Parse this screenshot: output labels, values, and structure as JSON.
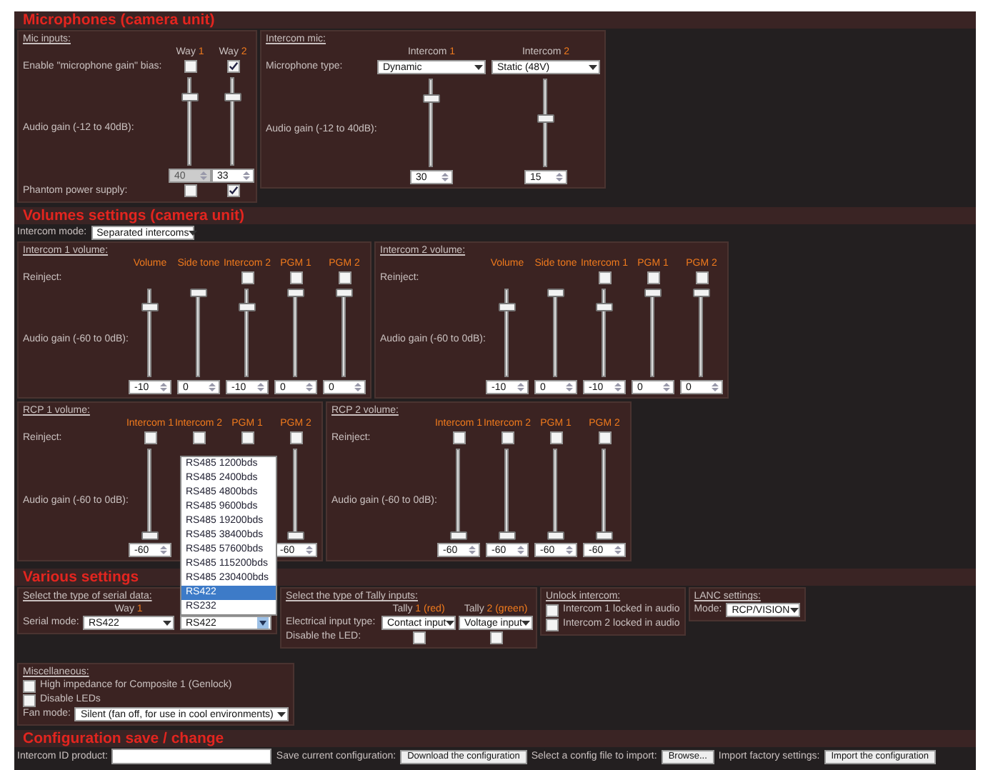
{
  "microphones": {
    "title": "Microphones (camera unit)",
    "panels": [
      {
        "title": "Mic inputs:",
        "columns": [
          {
            "label": "Way ",
            "accent": "1"
          },
          {
            "label": "Way ",
            "accent": "2"
          }
        ],
        "rows": [
          {
            "kind": "checkbox",
            "label": "Enable \"microphone gain\" bias:",
            "cells": [
              {
                "kind": "checkbox",
                "checked": false
              },
              {
                "kind": "checkbox",
                "checked": true
              }
            ]
          },
          {
            "kind": "slider",
            "label": "Audio gain (-12 to 40dB):",
            "cells": [
              {
                "kind": "slider",
                "level": 0.8,
                "value": "40",
                "disabled": true
              },
              {
                "kind": "slider",
                "level": 0.8,
                "value": "33",
                "disabled": false
              }
            ]
          },
          {
            "kind": "checkbox",
            "label": "Phantom power supply:",
            "cells": [
              {
                "kind": "checkbox",
                "checked": false
              },
              {
                "kind": "checkbox",
                "checked": true
              }
            ]
          }
        ]
      },
      {
        "title": "Intercom mic:",
        "columns": [
          {
            "label": "Intercom ",
            "accent": "1"
          },
          {
            "label": "Intercom ",
            "accent": "2"
          }
        ],
        "rows": [
          {
            "kind": "select",
            "label": "Microphone type:",
            "cells": [
              {
                "kind": "select",
                "value": "Dynamic"
              },
              {
                "kind": "select",
                "value": "Static (48V)"
              }
            ]
          },
          {
            "kind": "slider",
            "label": "Audio gain (-12 to 40dB):",
            "cells": [
              {
                "kind": "slider",
                "level": 0.8,
                "value": "30",
                "disabled": false
              },
              {
                "kind": "slider",
                "level": 0.55,
                "value": "15",
                "disabled": false
              }
            ]
          }
        ]
      }
    ]
  },
  "volumes": {
    "title": "Volumes settings (camera unit)",
    "mode_label": "Intercom mode:",
    "mode_value": "Separated intercoms",
    "panels": [
      {
        "title": "Intercom 1 volume:",
        "columns": [
          {
            "accent": "Volume"
          },
          {
            "accent": "Side tone"
          },
          {
            "accent": "Intercom 2"
          },
          {
            "accent": "PGM 1"
          },
          {
            "accent": "PGM 2"
          }
        ],
        "rows": [
          {
            "kind": "checkbox",
            "label": "Reinject:",
            "cells": [
              {
                "kind": "blank"
              },
              {
                "kind": "blank"
              },
              {
                "kind": "checkbox",
                "checked": false
              },
              {
                "kind": "checkbox",
                "checked": false
              },
              {
                "kind": "checkbox",
                "checked": false
              }
            ]
          },
          {
            "kind": "slider",
            "label": "Audio gain (-60 to 0dB):",
            "cells": [
              {
                "kind": "slider",
                "level": 0.83,
                "value": "-10",
                "disabled": false
              },
              {
                "kind": "slider",
                "level": 1,
                "value": "0",
                "disabled": false
              },
              {
                "kind": "slider",
                "level": 0.83,
                "value": "-10",
                "disabled": false
              },
              {
                "kind": "slider",
                "level": 1,
                "value": "0",
                "disabled": false
              },
              {
                "kind": "slider",
                "level": 1,
                "value": "0",
                "disabled": false
              }
            ]
          }
        ]
      },
      {
        "title": "Intercom 2 volume:",
        "columns": [
          {
            "accent": "Volume"
          },
          {
            "accent": "Side tone"
          },
          {
            "accent": "Intercom 1"
          },
          {
            "accent": "PGM 1"
          },
          {
            "accent": "PGM 2"
          }
        ],
        "rows": [
          {
            "kind": "checkbox",
            "label": "Reinject:",
            "cells": [
              {
                "kind": "blank"
              },
              {
                "kind": "blank"
              },
              {
                "kind": "checkbox",
                "checked": false
              },
              {
                "kind": "checkbox",
                "checked": false
              },
              {
                "kind": "checkbox",
                "checked": false
              }
            ]
          },
          {
            "kind": "slider",
            "label": "Audio gain (-60 to 0dB):",
            "cells": [
              {
                "kind": "slider",
                "level": 0.83,
                "value": "-10",
                "disabled": false
              },
              {
                "kind": "slider",
                "level": 1,
                "value": "0",
                "disabled": false
              },
              {
                "kind": "slider",
                "level": 0.83,
                "value": "-10",
                "disabled": false
              },
              {
                "kind": "slider",
                "level": 1,
                "value": "0",
                "disabled": false
              },
              {
                "kind": "slider",
                "level": 1,
                "value": "0",
                "disabled": false
              }
            ]
          }
        ]
      },
      {
        "title": "RCP 1 volume:",
        "columns": [
          {
            "accent": "Intercom 1"
          },
          {
            "accent": "Intercom 2"
          },
          {
            "accent": "PGM 1"
          },
          {
            "accent": "PGM 2"
          }
        ],
        "rows": [
          {
            "kind": "checkbox",
            "label": "Reinject:",
            "cells": [
              {
                "kind": "checkbox",
                "checked": false
              },
              {
                "kind": "checkbox",
                "checked": false
              },
              {
                "kind": "checkbox",
                "checked": false
              },
              {
                "kind": "checkbox",
                "checked": false
              }
            ]
          },
          {
            "kind": "slider",
            "label": "Audio gain (-60 to 0dB):",
            "cells": [
              {
                "kind": "slider",
                "level": 0,
                "value": "-60",
                "disabled": false
              },
              {
                "kind": "blank"
              },
              {
                "kind": "blank"
              },
              {
                "kind": "slider",
                "level": 0,
                "value": "-60",
                "disabled": false
              }
            ]
          }
        ]
      },
      {
        "title": "RCP 2 volume:",
        "columns": [
          {
            "accent": "Intercom 1"
          },
          {
            "accent": "Intercom 2"
          },
          {
            "accent": "PGM 1"
          },
          {
            "accent": "PGM 2"
          }
        ],
        "rows": [
          {
            "kind": "checkbox",
            "label": "Reinject:",
            "cells": [
              {
                "kind": "checkbox",
                "checked": false
              },
              {
                "kind": "checkbox",
                "checked": false
              },
              {
                "kind": "checkbox",
                "checked": false
              },
              {
                "kind": "checkbox",
                "checked": false
              }
            ]
          },
          {
            "kind": "slider",
            "label": "Audio gain (-60 to 0dB):",
            "cells": [
              {
                "kind": "slider",
                "level": 0,
                "value": "-60",
                "disabled": false
              },
              {
                "kind": "slider",
                "level": 0,
                "value": "-60",
                "disabled": false
              },
              {
                "kind": "slider",
                "level": 0,
                "value": "-60",
                "disabled": false
              },
              {
                "kind": "slider",
                "level": 0,
                "value": "-60",
                "disabled": false
              }
            ]
          }
        ]
      }
    ]
  },
  "various": {
    "title": "Various settings",
    "serial": {
      "title": "Select the type of serial data:",
      "columns": [
        {
          "label": "Way ",
          "accent": "1"
        }
      ],
      "label": "Serial mode:",
      "selects": [
        {
          "value": "RS422",
          "open": false
        },
        {
          "value": "RS422",
          "open": true,
          "options": [
            {
              "label": "RS485 1200bds",
              "selected": false
            },
            {
              "label": "RS485 2400bds",
              "selected": false
            },
            {
              "label": "RS485 4800bds",
              "selected": false
            },
            {
              "label": "RS485 9600bds",
              "selected": false
            },
            {
              "label": "RS485 19200bds",
              "selected": false
            },
            {
              "label": "RS485 38400bds",
              "selected": false
            },
            {
              "label": "RS485 57600bds",
              "selected": false
            },
            {
              "label": "RS485 115200bds",
              "selected": false
            },
            {
              "label": "RS485 230400bds",
              "selected": false
            },
            {
              "label": "RS422",
              "selected": true
            },
            {
              "label": "RS232",
              "selected": false
            }
          ]
        }
      ]
    },
    "tally": {
      "title": "Select the type of Tally inputs:",
      "columns": [
        {
          "label": "Tally ",
          "accent": "1 (red)"
        },
        {
          "label": "Tally ",
          "accent": "2 (green)"
        }
      ],
      "input_label": "Electrical input type:",
      "inputs": [
        "Contact input",
        "Voltage input"
      ],
      "led_label": "Disable the LED:",
      "leds": [
        {
          "checked": false
        },
        {
          "checked": false
        }
      ]
    },
    "unlock": {
      "title": "Unlock intercom:",
      "items": [
        {
          "label": "Intercom 1 locked in audio",
          "checked": false
        },
        {
          "label": "Intercom 2 locked in audio",
          "checked": false
        }
      ]
    },
    "lanc": {
      "title": "LANC settings:",
      "label": "Mode:",
      "value": "RCP/VISION"
    },
    "misc": {
      "title": "Miscellaneous:",
      "items": [
        {
          "label": "High impedance for Composite 1 (Genlock)",
          "checked": false
        },
        {
          "label": "Disable LEDs",
          "checked": false
        }
      ],
      "fan_label": "Fan mode:",
      "fan_value": "Silent (fan off, for use in cool environments)"
    }
  },
  "config": {
    "title": "Configuration save / change",
    "id_label": "Intercom ID product:",
    "save_label": "Save current configuration:",
    "save_button": "Download the configuration",
    "import_label": "Select a config file to import:",
    "browse_button": "Browse...",
    "factory_label": "Import factory settings:",
    "import_button": "Import the configuration"
  }
}
